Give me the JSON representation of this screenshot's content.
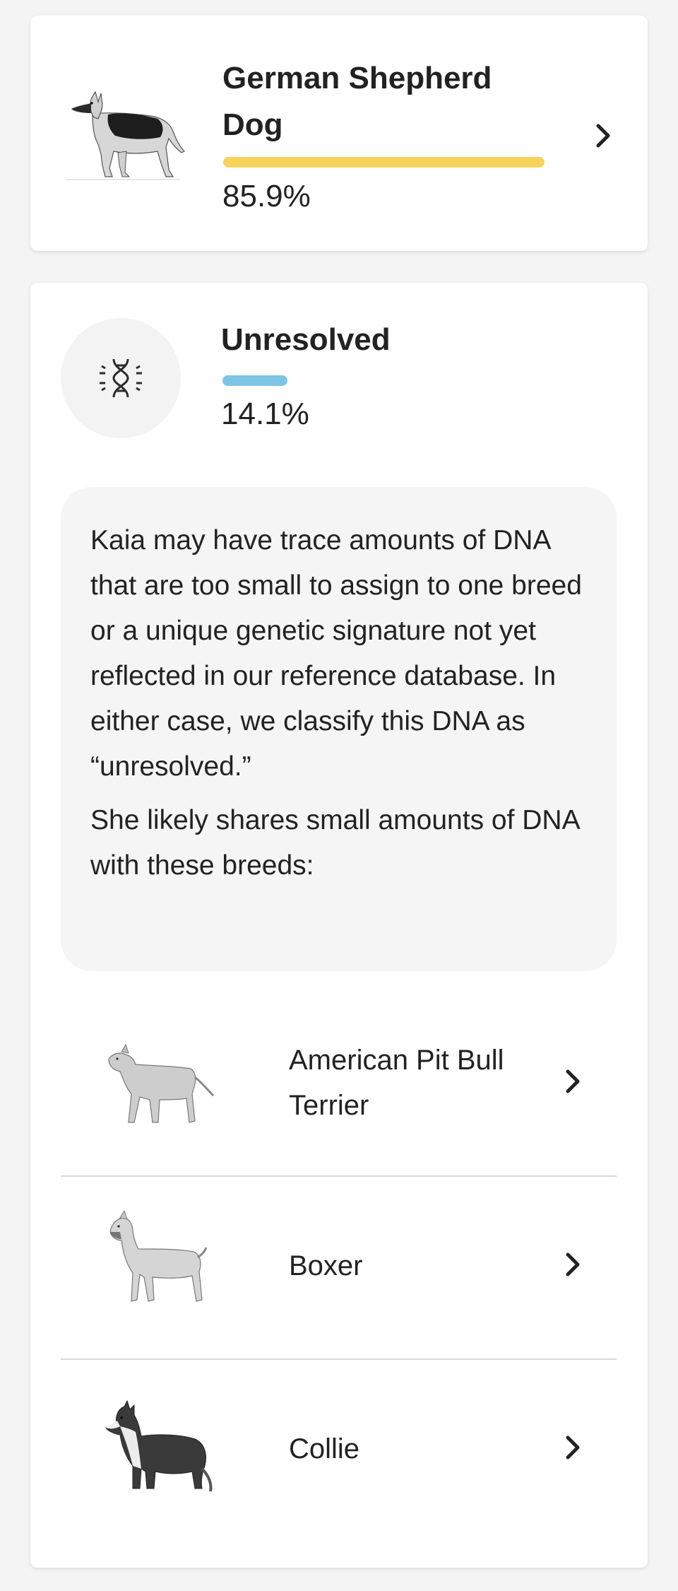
{
  "top_breed": {
    "name": "German Shepherd Dog",
    "percent": 85.9,
    "percent_label": "85.9%",
    "bar_color": "#f7d35b",
    "image_icon": "german-shepherd-illustration",
    "chevron_icon": "chevron-right-icon"
  },
  "unresolved": {
    "icon": "dna-icon",
    "title": "Unresolved",
    "percent": 14.1,
    "percent_label": "14.1%",
    "bar_color": "#7ec4e6",
    "description": "Kaia may have trace amounts of DNA that are too small to assign to one breed or a unique genetic signature not yet reflected in our reference database. In either case, we classify this DNA as “unresolved.”",
    "shares_text": "She likely shares small amounts of DNA with these breeds:",
    "breeds": [
      {
        "name": "American Pit Bull Terrier",
        "icon": "pit-bull-illustration"
      },
      {
        "name": "Boxer",
        "icon": "boxer-illustration"
      },
      {
        "name": "Collie",
        "icon": "collie-illustration"
      }
    ]
  }
}
